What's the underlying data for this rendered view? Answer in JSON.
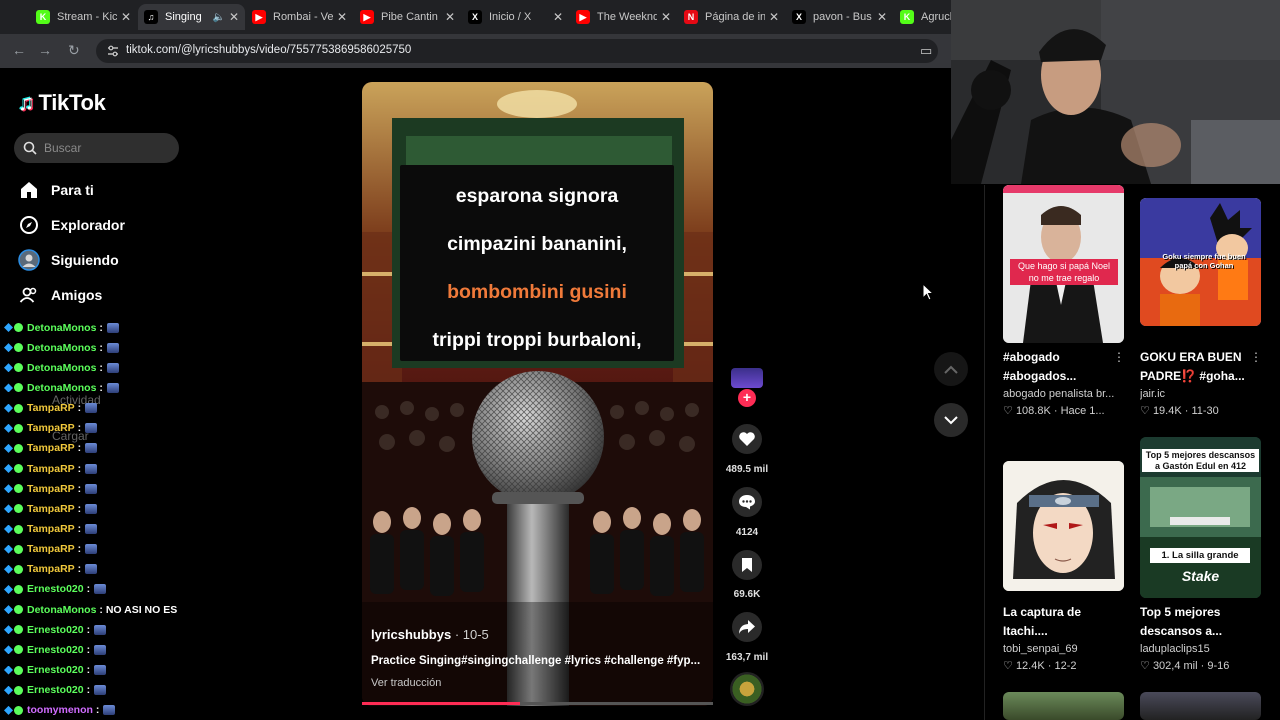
{
  "browser": {
    "tabs": [
      {
        "title": "Stream - Kick",
        "icon": "kick-icon",
        "color": "#53fc18",
        "active": false
      },
      {
        "title": "Singing",
        "icon": "tiktok-icon",
        "color": "#000000",
        "active": true
      },
      {
        "title": "Rombai - Ve",
        "icon": "youtube-icon",
        "color": "#ff0000",
        "active": false
      },
      {
        "title": "Pibe Cantin",
        "icon": "youtube-icon",
        "color": "#ff0000",
        "active": false
      },
      {
        "title": "Inicio / X",
        "icon": "x-icon",
        "color": "#000000",
        "active": false
      },
      {
        "title": "The Weeknd",
        "icon": "youtube-icon",
        "color": "#ff0000",
        "active": false
      },
      {
        "title": "Página de in",
        "icon": "netflix-icon",
        "color": "#e50914",
        "active": false
      },
      {
        "title": "pavon - Bus",
        "icon": "x-icon",
        "color": "#000000",
        "active": false
      },
      {
        "title": "Agruck S",
        "icon": "kick-icon",
        "color": "#53fc18",
        "active": false
      }
    ],
    "url": "tiktok.com/@lyricshubbys/video/7557753869586025750"
  },
  "sidebar": {
    "logo": "TikTok",
    "search_placeholder": "Buscar",
    "items": [
      {
        "label": "Para ti",
        "icon": "home-icon"
      },
      {
        "label": "Explorador",
        "icon": "compass-icon"
      },
      {
        "label": "Siguiendo",
        "icon": "following-avatar-icon"
      },
      {
        "label": "Amigos",
        "icon": "friends-icon"
      }
    ],
    "faded_items": [
      "Actividad",
      "Cargar"
    ]
  },
  "chat": [
    {
      "user": "DetonaMonos",
      "color": "#5cff5c",
      "msg": ":"
    },
    {
      "user": "DetonaMonos",
      "color": "#5cff5c",
      "msg": ":"
    },
    {
      "user": "DetonaMonos",
      "color": "#5cff5c",
      "msg": ":"
    },
    {
      "user": "DetonaMonos",
      "color": "#5cff5c",
      "msg": ":"
    },
    {
      "user": "TampaRP",
      "color": "#f0c83c",
      "msg": ":"
    },
    {
      "user": "TampaRP",
      "color": "#f0c83c",
      "msg": ":"
    },
    {
      "user": "TampaRP",
      "color": "#f0c83c",
      "msg": ":"
    },
    {
      "user": "TampaRP",
      "color": "#f0c83c",
      "msg": ":"
    },
    {
      "user": "TampaRP",
      "color": "#f0c83c",
      "msg": ":"
    },
    {
      "user": "TampaRP",
      "color": "#f0c83c",
      "msg": ":"
    },
    {
      "user": "TampaRP",
      "color": "#f0c83c",
      "msg": ":"
    },
    {
      "user": "TampaRP",
      "color": "#f0c83c",
      "msg": ":"
    },
    {
      "user": "TampaRP",
      "color": "#f0c83c",
      "msg": ":"
    },
    {
      "user": "Ernesto020",
      "color": "#5cff5c",
      "msg": ":"
    },
    {
      "user": "DetonaMonos",
      "color": "#5cff5c",
      "msg": ": NO ASI NO ES"
    },
    {
      "user": "Ernesto020",
      "color": "#5cff5c",
      "msg": ":"
    },
    {
      "user": "Ernesto020",
      "color": "#5cff5c",
      "msg": ":"
    },
    {
      "user": "Ernesto020",
      "color": "#5cff5c",
      "msg": ":"
    },
    {
      "user": "Ernesto020",
      "color": "#5cff5c",
      "msg": ":"
    },
    {
      "user": "toomymenon",
      "color": "#d06cff",
      "msg": ":"
    }
  ],
  "video": {
    "lyrics": [
      {
        "text": "esparona signora",
        "color": "#ffffff"
      },
      {
        "text": "cimpazini bananini,",
        "color": "#ffffff"
      },
      {
        "text": "bombombini gusini",
        "color": "#f07a3a"
      },
      {
        "text": "trippi troppi burbaloni,",
        "color": "#ffffff"
      }
    ],
    "author": "lyricshubbys",
    "date": " · 10-5",
    "caption": "Practice Singing#singingchallenge #lyrics #challenge #fyp...",
    "translate": "Ver traducción",
    "progress": 0.45
  },
  "actions": {
    "likes": "489.5 mil",
    "comments": "4124",
    "saves": "69.6K",
    "shares": "163,7 mil"
  },
  "recommendations": [
    {
      "title": "#abogado #abogados...",
      "author": "abogado penalista br...",
      "stats": "108.8K · Hace 1...",
      "overlay": "Que hago si papá Noel no me trae regalo"
    },
    {
      "title": "GOKU ERA BUEN PADRE⁉️ #goha...",
      "author": "jair.ic",
      "stats": "19.4K · 11-30",
      "overlay": "Goku siempre fue buen papá con Gohan"
    },
    {
      "title": "La captura de Itachi....",
      "author": "tobi_senpai_69",
      "stats": "12.4K · 12-2",
      "overlay": ""
    },
    {
      "title": "Top 5 mejores descansos a...",
      "author": "laduplaclips15",
      "stats": "302,4 mil · 9-16",
      "overlay": "Top 5 mejores descansos a Gastón Edul en 412"
    }
  ],
  "rec_extra": {
    "badge": "1. La silla grande",
    "brand": "Stake"
  }
}
